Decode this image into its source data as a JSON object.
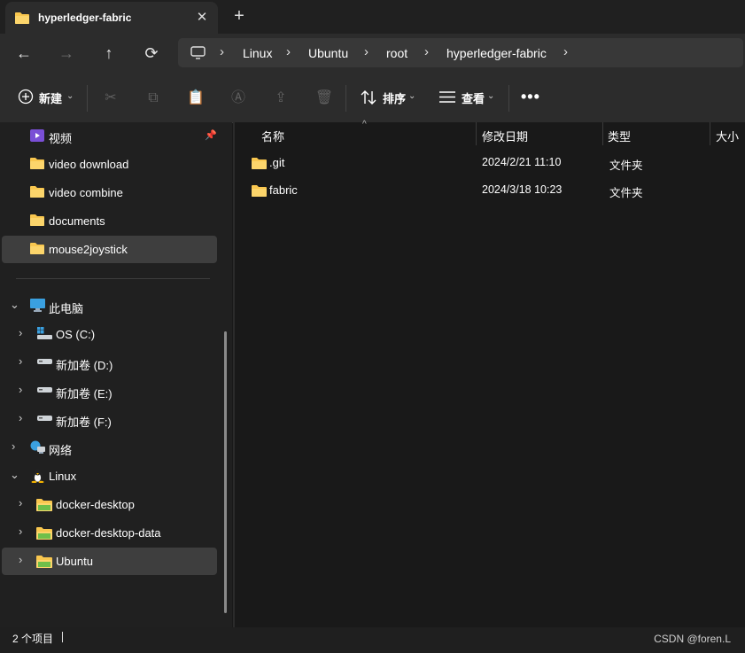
{
  "tab": {
    "title": "hyperledger-fabric",
    "close": "✕",
    "new_tab": "+"
  },
  "nav": {
    "back": "←",
    "forward": "→",
    "up": "↑",
    "refresh": "⟳"
  },
  "breadcrumb": {
    "items": [
      "Linux",
      "Ubuntu",
      "root",
      "hyperledger-fabric"
    ],
    "separator": "›"
  },
  "toolbar": {
    "new_label": "新建",
    "sort_label": "排序",
    "view_label": "查看",
    "more": "•••"
  },
  "sidebar": {
    "quick": [
      {
        "label": "视频",
        "icon": "video-folder-icon",
        "pinned": true
      },
      {
        "label": "video download",
        "icon": "folder-icon"
      },
      {
        "label": "video combine",
        "icon": "folder-icon"
      },
      {
        "label": "documents",
        "icon": "folder-icon"
      },
      {
        "label": "mouse2joystick",
        "icon": "folder-icon",
        "selected": true
      }
    ],
    "this_pc": "此电脑",
    "drives": [
      {
        "label": "OS (C:)",
        "icon": "windows-drive-icon"
      },
      {
        "label": "新加卷 (D:)",
        "icon": "drive-icon"
      },
      {
        "label": "新加卷 (E:)",
        "icon": "drive-icon"
      },
      {
        "label": "新加卷 (F:)",
        "icon": "drive-icon"
      }
    ],
    "network": "网络",
    "linux": "Linux",
    "linux_items": [
      {
        "label": "docker-desktop",
        "icon": "linux-folder-icon"
      },
      {
        "label": "docker-desktop-data",
        "icon": "linux-folder-icon"
      },
      {
        "label": "Ubuntu",
        "icon": "linux-folder-icon",
        "selected": true
      }
    ]
  },
  "columns": {
    "name": "名称",
    "date": "修改日期",
    "type": "类型",
    "size": "大小"
  },
  "files": [
    {
      "name": ".git",
      "date": "2024/2/21 11:10",
      "type": "文件夹"
    },
    {
      "name": "fabric",
      "date": "2024/3/18 10:23",
      "type": "文件夹"
    }
  ],
  "status": {
    "count": "2 个项目"
  },
  "watermark": "CSDN @foren.L",
  "colors": {
    "folder": "#f9c74f",
    "background": "#191919",
    "selected": "#3e3e3e"
  }
}
